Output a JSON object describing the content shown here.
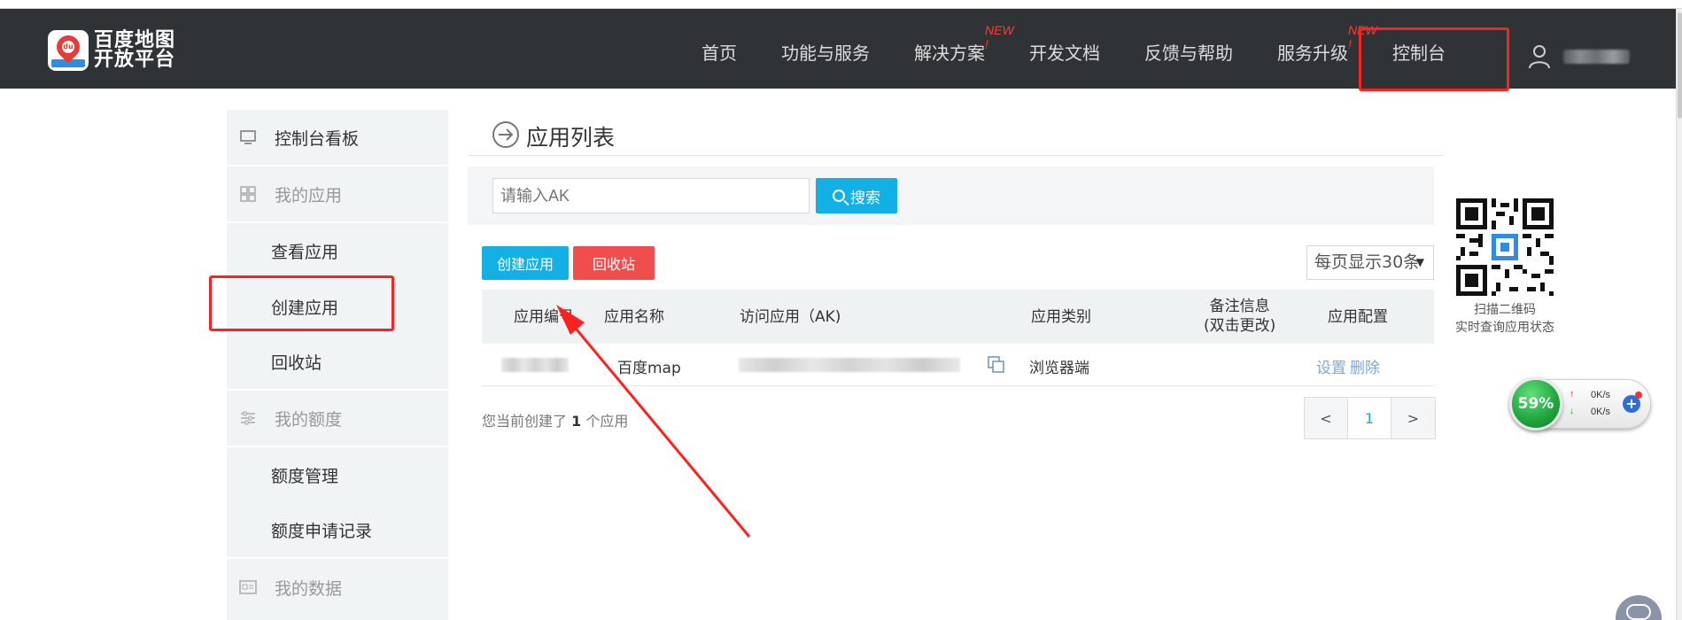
{
  "header": {
    "logo_line1": "百度地图",
    "logo_line2": "开放平台",
    "logo_badge": "du",
    "nav": [
      {
        "label": "首页"
      },
      {
        "label": "功能与服务"
      },
      {
        "label": "解决方案",
        "tag": "NEW !"
      },
      {
        "label": "开发文档"
      },
      {
        "label": "反馈与帮助"
      },
      {
        "label": "服务升级",
        "tag": "NEW !"
      },
      {
        "label": "控制台"
      }
    ]
  },
  "sidebar": {
    "dashboard": "控制台看板",
    "my_apps": "我的应用",
    "view_apps": "查看应用",
    "create_app": "创建应用",
    "recycle_bin": "回收站",
    "my_quota": "我的额度",
    "quota_manage": "额度管理",
    "quota_records": "额度申请记录",
    "my_data": "我的数据"
  },
  "main": {
    "title": "应用列表",
    "search_placeholder": "请输入AK",
    "search_button": "搜索",
    "create_button": "创建应用",
    "recycle_button": "回收站",
    "per_page": "每页显示30条",
    "per_page_caret": "▼",
    "columns": {
      "app_id": "应用编号",
      "app_name": "应用名称",
      "ak": "访问应用（AK)",
      "category": "应用类别",
      "remark_line1": "备注信息",
      "remark_line2": "(双击更改)",
      "config": "应用配置"
    },
    "rows": [
      {
        "app_name": "百度map",
        "category": "浏览器端",
        "settings": "设置",
        "delete": "删除"
      }
    ],
    "summary_prefix": "您当前创建了",
    "summary_count": "1",
    "summary_suffix": "个应用",
    "pager": {
      "prev": "<",
      "page": "1",
      "next": ">"
    }
  },
  "qr": {
    "caption_line1": "扫描二维码",
    "caption_line2": "实时查询应用状态"
  },
  "speed_widget": {
    "percent": "59%",
    "up": "0K/s",
    "down": "0K/s",
    "plus": "+"
  },
  "colors": {
    "header_bg": "#2f3336",
    "accent": "#13b0e6",
    "danger": "#f04d4d",
    "annotation": "#ff2020",
    "new_tag": "#ff3b30"
  }
}
